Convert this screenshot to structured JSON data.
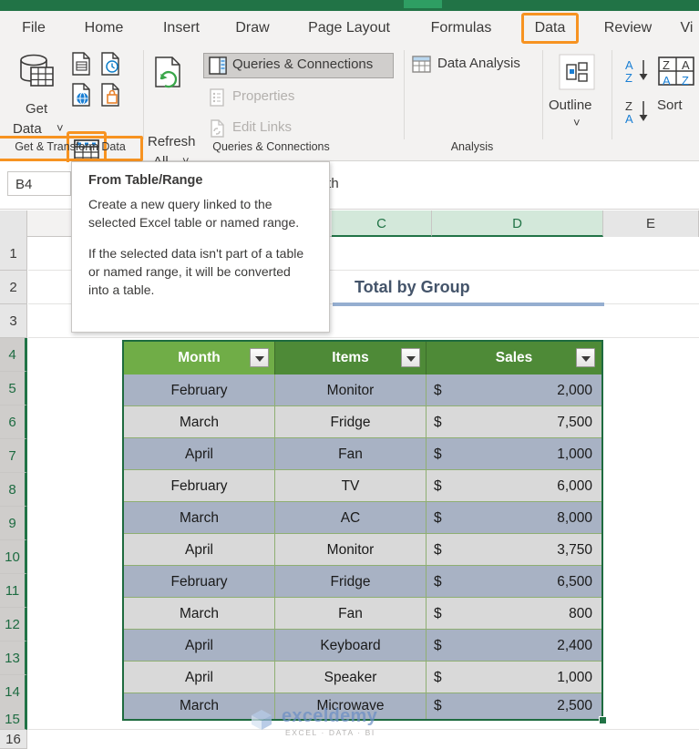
{
  "app": {
    "name": "Microsoft Excel",
    "accent_green": "#217346",
    "highlight_orange": "#f79321"
  },
  "ribbon": {
    "tabs": [
      {
        "label": "File",
        "selected": false
      },
      {
        "label": "Home",
        "selected": false
      },
      {
        "label": "Insert",
        "selected": false
      },
      {
        "label": "Draw",
        "selected": false
      },
      {
        "label": "Page Layout",
        "selected": false
      },
      {
        "label": "Formulas",
        "selected": false
      },
      {
        "label": "Data",
        "selected": true
      },
      {
        "label": "Review",
        "selected": false
      },
      {
        "label": "Vi",
        "selected": false
      }
    ],
    "groups": [
      {
        "label": "Get & Transform Data",
        "highlighted": true
      },
      {
        "label": "Queries & Connections",
        "highlighted": false
      },
      {
        "label": "Analysis",
        "highlighted": false
      }
    ],
    "get_data": {
      "line1": "Get",
      "line2": "Data",
      "dropdown_caret": "˅",
      "icons": [
        "database-table-icon",
        "from-text-csv-icon",
        "from-recent-sources-icon",
        "from-web-icon",
        "from-other-sources-icon",
        "from-table-range-icon"
      ],
      "highlighted_icon": "from-table-range-icon"
    },
    "queries": {
      "refresh_line1": "Refresh",
      "refresh_line2": "All",
      "refresh_caret": "˅",
      "queries_connections": "Queries & Connections",
      "queries_connections_active": true,
      "properties": "Properties",
      "properties_enabled": false,
      "edit_links": "Edit Links",
      "edit_links_enabled": false
    },
    "analysis": {
      "data_analysis": "Data Analysis"
    },
    "outline": {
      "label": "Outline",
      "caret": "˅"
    },
    "sort": {
      "label": "Sort",
      "asc_top": "A",
      "asc_bottom": "Z",
      "desc_top": "Z",
      "desc_bottom": "A",
      "sort_top_left": "Z",
      "sort_top_right": "A",
      "sort_bottom_left": "A",
      "sort_bottom_right": "Z"
    }
  },
  "formula_bar": {
    "name_box_value": "B4",
    "formula_value": "Month"
  },
  "tooltip": {
    "title": "From Table/Range",
    "paragraph1": "Create a new query linked to the selected Excel table or named range.",
    "paragraph2": "If the selected data isn't part of a table or named range, it will be converted into a table."
  },
  "grid": {
    "column_headers": [
      {
        "label": "C",
        "selected": true
      },
      {
        "label": "D",
        "selected": true
      },
      {
        "label": "E",
        "selected": false
      }
    ],
    "row_headers": [
      {
        "label": "1",
        "selected": false
      },
      {
        "label": "2",
        "selected": false
      },
      {
        "label": "3",
        "selected": false
      },
      {
        "label": "4",
        "selected": true
      },
      {
        "label": "5",
        "selected": true
      },
      {
        "label": "6",
        "selected": true
      },
      {
        "label": "7",
        "selected": true
      },
      {
        "label": "8",
        "selected": true
      },
      {
        "label": "9",
        "selected": true
      },
      {
        "label": "10",
        "selected": true
      },
      {
        "label": "11",
        "selected": true
      },
      {
        "label": "12",
        "selected": true
      },
      {
        "label": "13",
        "selected": true
      },
      {
        "label": "14",
        "selected": true
      },
      {
        "label": "15",
        "selected": true
      },
      {
        "label": "16",
        "selected": false
      }
    ]
  },
  "sheet": {
    "heading": "Total by Group"
  },
  "table": {
    "headers": [
      "Month",
      "Items",
      "Sales"
    ],
    "active_header_index": 0,
    "currency_symbol": "$",
    "rows": [
      {
        "month": "February",
        "items": "Monitor",
        "sales": "2,000"
      },
      {
        "month": "March",
        "items": "Fridge",
        "sales": "7,500"
      },
      {
        "month": "April",
        "items": "Fan",
        "sales": "1,000"
      },
      {
        "month": "February",
        "items": "TV",
        "sales": "6,000"
      },
      {
        "month": "March",
        "items": "AC",
        "sales": "8,000"
      },
      {
        "month": "April",
        "items": "Monitor",
        "sales": "3,750"
      },
      {
        "month": "February",
        "items": "Fridge",
        "sales": "6,500"
      },
      {
        "month": "March",
        "items": "Fan",
        "sales": "800"
      },
      {
        "month": "April",
        "items": "Keyboard",
        "sales": "2,400"
      },
      {
        "month": "April",
        "items": "Speaker",
        "sales": "1,000"
      },
      {
        "month": "March",
        "items": "Microwave",
        "sales": "2,500"
      }
    ]
  },
  "watermark": {
    "brand": "exceldemy",
    "tagline": "EXCEL · DATA · BI"
  }
}
